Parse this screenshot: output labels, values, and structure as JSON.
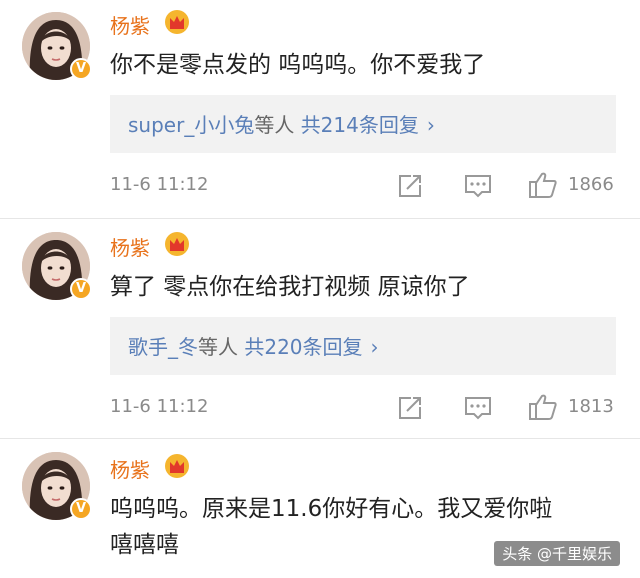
{
  "comments": [
    {
      "username": "杨紫",
      "text_lines": [
        "你不是零点发的 呜呜呜。你不爱我了"
      ],
      "reply": {
        "users": "super_小小兔",
        "suffix": "等人",
        "count": "共214条回复"
      },
      "time": "11-6 11:12",
      "likes": "1866"
    },
    {
      "username": "杨紫",
      "text_lines": [
        "算了 零点你在给我打视频 原谅你了"
      ],
      "reply": {
        "users": "歌手_冬",
        "suffix": "等人",
        "count": "共220条回复"
      },
      "time": "11-6 11:12",
      "likes": "1813"
    },
    {
      "username": "杨紫",
      "text_lines": [
        "呜呜呜。原来是11.6你好有心。我又爱你啦",
        "嘻嘻嘻"
      ]
    }
  ],
  "watermark": "头条 @千里娱乐",
  "icons": {
    "verified": "verified-v-badge-icon",
    "vip": "crown-icon",
    "share": "share-icon",
    "comment": "comment-icon",
    "like": "thumbs-up-icon"
  },
  "colors": {
    "username": "#e8731c",
    "link": "#5a7fb8",
    "badge": "#f5a623"
  }
}
